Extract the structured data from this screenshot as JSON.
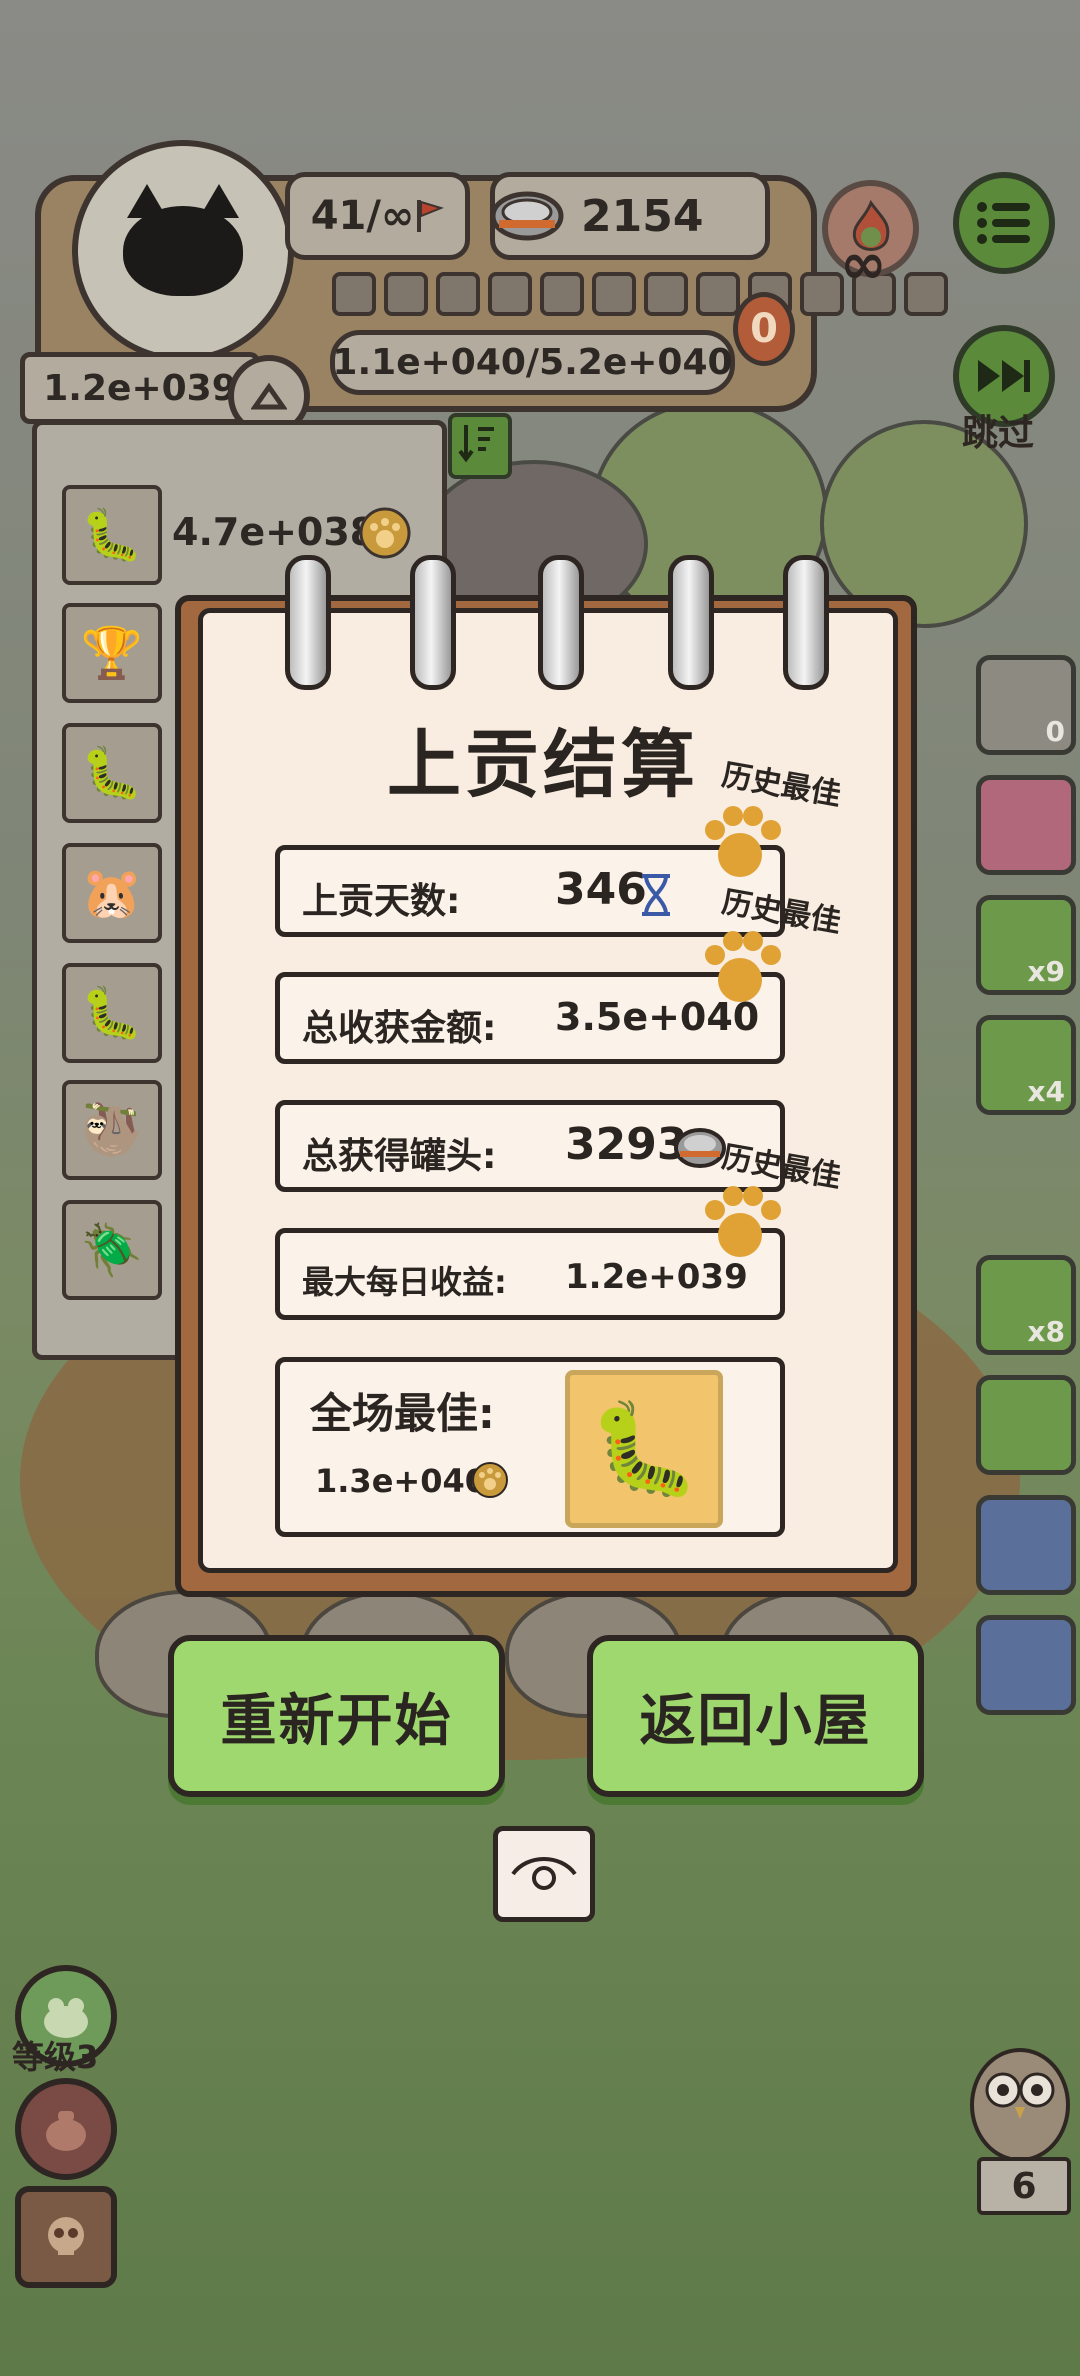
{
  "top_bar": {
    "round_progress": "41/∞",
    "cans_count": "2154",
    "tribute_progress": "1.1e+040/5.2e+040",
    "badge_value": "0",
    "infinity_symbol": "∞",
    "skip_label": "跳过",
    "income_rate": "1.2e+039"
  },
  "left_list": {
    "first_value": "4.7e+038",
    "slots": [
      "armadillo",
      "trophy",
      "armadillo",
      "hamster",
      "armadillo",
      "sloth",
      "dung-beetle"
    ]
  },
  "right_rail": {
    "rock_count": "0",
    "candy_count": "x9",
    "ticket_count": "x4",
    "helmet_count": "x8"
  },
  "notebook": {
    "title": "上贡结算",
    "rows": [
      {
        "label": "上贡天数:",
        "value": "346",
        "icon": "hourglass-icon",
        "best": "历史最佳"
      },
      {
        "label": "总收获金额:",
        "value": "3.5e+040",
        "icon": "gold-icon",
        "best": "历史最佳"
      },
      {
        "label": "总获得罐头:",
        "value": "3293",
        "icon": "can-icon",
        "best": ""
      },
      {
        "label": "最大每日收益:",
        "value": "1.2e+039",
        "icon": "gold-icon",
        "best": "历史最佳"
      }
    ],
    "overall_best_label": "全场最佳:",
    "overall_best_value": "1.3e+040",
    "overall_best_creature": "armadillo"
  },
  "buttons": {
    "restart": "重新开始",
    "return_home": "返回小屋"
  },
  "bottom_left": {
    "level_label": "等级3"
  },
  "bottom_right": {
    "owl_count": "6"
  },
  "colors": {
    "paper": "#f9ece0",
    "notebook_cover": "#a2683f",
    "button_green": "#9ed86e",
    "paw_gold": "#e0a234"
  }
}
